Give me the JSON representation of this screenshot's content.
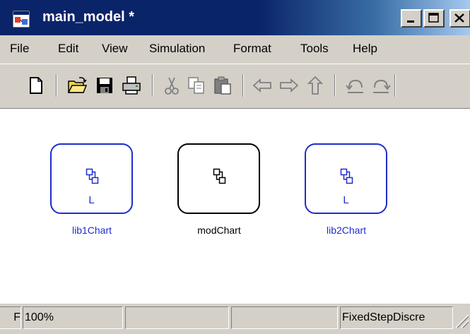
{
  "window": {
    "title": "main_model *"
  },
  "menu": [
    "File",
    "Edit",
    "View",
    "Simulation",
    "Format",
    "Tools",
    "Help"
  ],
  "toolbar": {
    "tools": [
      "new-icon",
      "open-icon",
      "save-icon",
      "print-icon",
      "cut-icon",
      "copy-icon",
      "paste-icon",
      "back-icon",
      "forward-icon",
      "up-icon",
      "undo-icon",
      "redo-icon"
    ]
  },
  "blocks": [
    {
      "label": "lib1Chart",
      "library_marker": "L",
      "color": "#1f2dcc"
    },
    {
      "label": "modChart",
      "library_marker": "",
      "color": "#000000"
    },
    {
      "label": "lib2Chart",
      "library_marker": "L",
      "color": "#1f2dcc"
    }
  ],
  "status": {
    "first_cell": "F",
    "zoom": "100%",
    "solver": "FixedStepDiscre"
  }
}
